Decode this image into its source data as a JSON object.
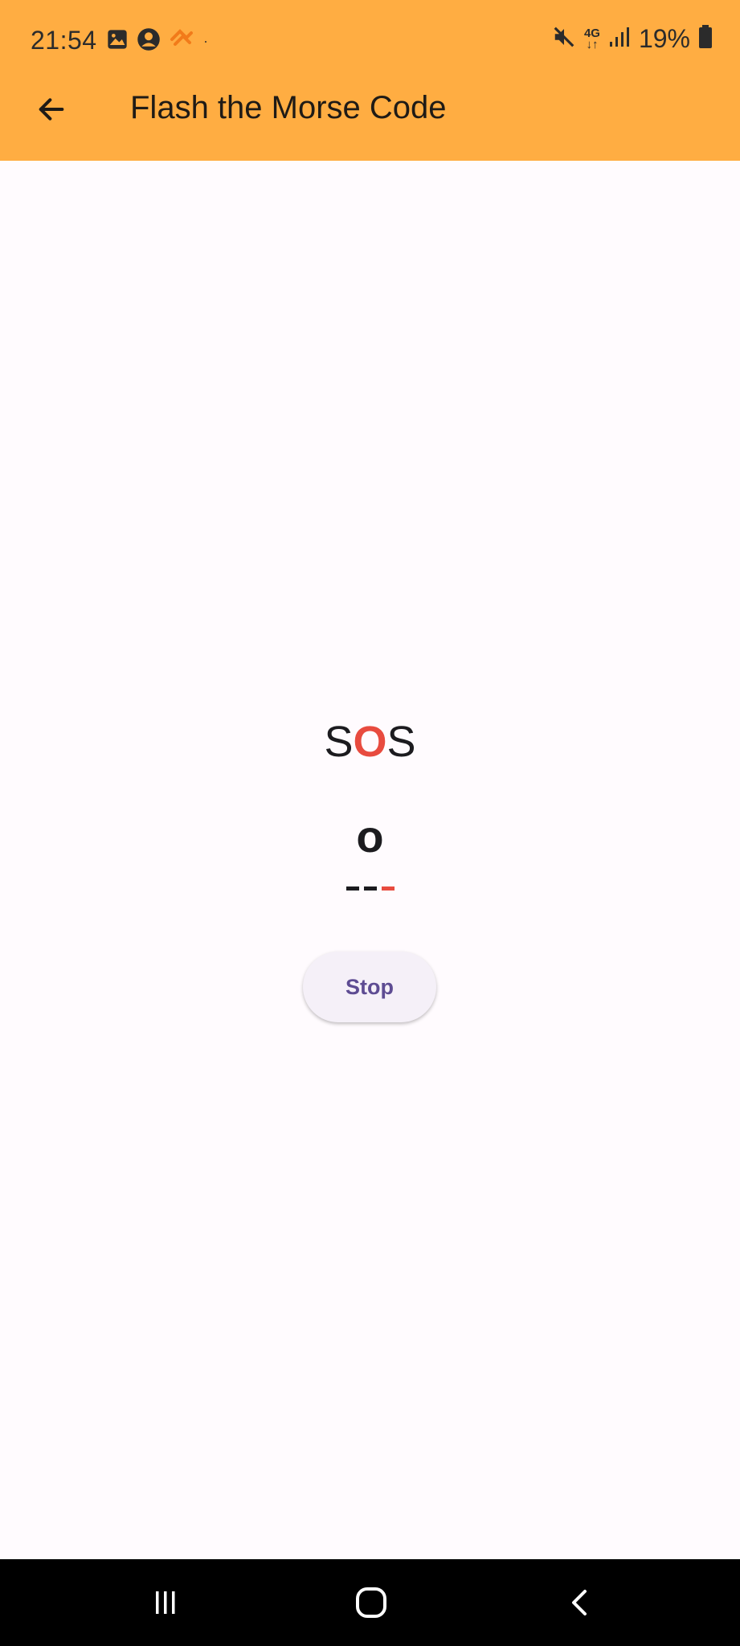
{
  "status_bar": {
    "time": "21:54",
    "network": "4G",
    "battery": "19%",
    "icons": [
      "gallery-icon",
      "account-icon",
      "app-icon",
      "mute-icon",
      "signal-icon",
      "battery-icon"
    ]
  },
  "app_bar": {
    "title": "Flash the Morse Code",
    "back_icon": "arrow-back-icon",
    "background": "#FFAD42"
  },
  "morse": {
    "word": {
      "before": "S",
      "current": "O",
      "after": "S"
    },
    "current_letter": "o",
    "code": [
      "-",
      "-",
      "-"
    ],
    "active_symbol_index": 2,
    "accent": "#E84B3F"
  },
  "actions": {
    "stop_label": "Stop",
    "stop_color": "#5E4C93"
  },
  "nav_bar": {
    "items": [
      "recent-apps-icon",
      "home-icon",
      "back-icon"
    ]
  }
}
